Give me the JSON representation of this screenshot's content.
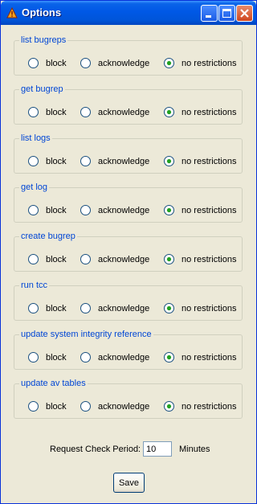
{
  "window": {
    "title": "Options",
    "icon": "triangle-warning-icon",
    "controls": [
      "minimize-icon",
      "maximize-icon",
      "close-icon"
    ]
  },
  "permissions": [
    {
      "label": "list bugreps",
      "options": [
        "block",
        "acknowledge",
        "no restrictions"
      ],
      "selected": "no restrictions"
    },
    {
      "label": "get bugrep",
      "options": [
        "block",
        "acknowledge",
        "no restrictions"
      ],
      "selected": "no restrictions"
    },
    {
      "label": "list logs",
      "options": [
        "block",
        "acknowledge",
        "no restrictions"
      ],
      "selected": "no restrictions"
    },
    {
      "label": "get log",
      "options": [
        "block",
        "acknowledge",
        "no restrictions"
      ],
      "selected": "no restrictions"
    },
    {
      "label": "create bugrep",
      "options": [
        "block",
        "acknowledge",
        "no restrictions"
      ],
      "selected": "no restrictions"
    },
    {
      "label": "run tcc",
      "options": [
        "block",
        "acknowledge",
        "no restrictions"
      ],
      "selected": "no restrictions"
    },
    {
      "label": "update system integrity reference",
      "options": [
        "block",
        "acknowledge",
        "no restrictions"
      ],
      "selected": "no restrictions"
    },
    {
      "label": "update av tables",
      "options": [
        "block",
        "acknowledge",
        "no restrictions"
      ],
      "selected": "no restrictions"
    }
  ],
  "request_check": {
    "label": "Request Check Period:",
    "value": "10",
    "unit": "Minutes"
  },
  "save_label": "Save",
  "colors": {
    "titlebar": "#0058e6",
    "group_label": "#0046d5",
    "background": "#ece9d8"
  }
}
